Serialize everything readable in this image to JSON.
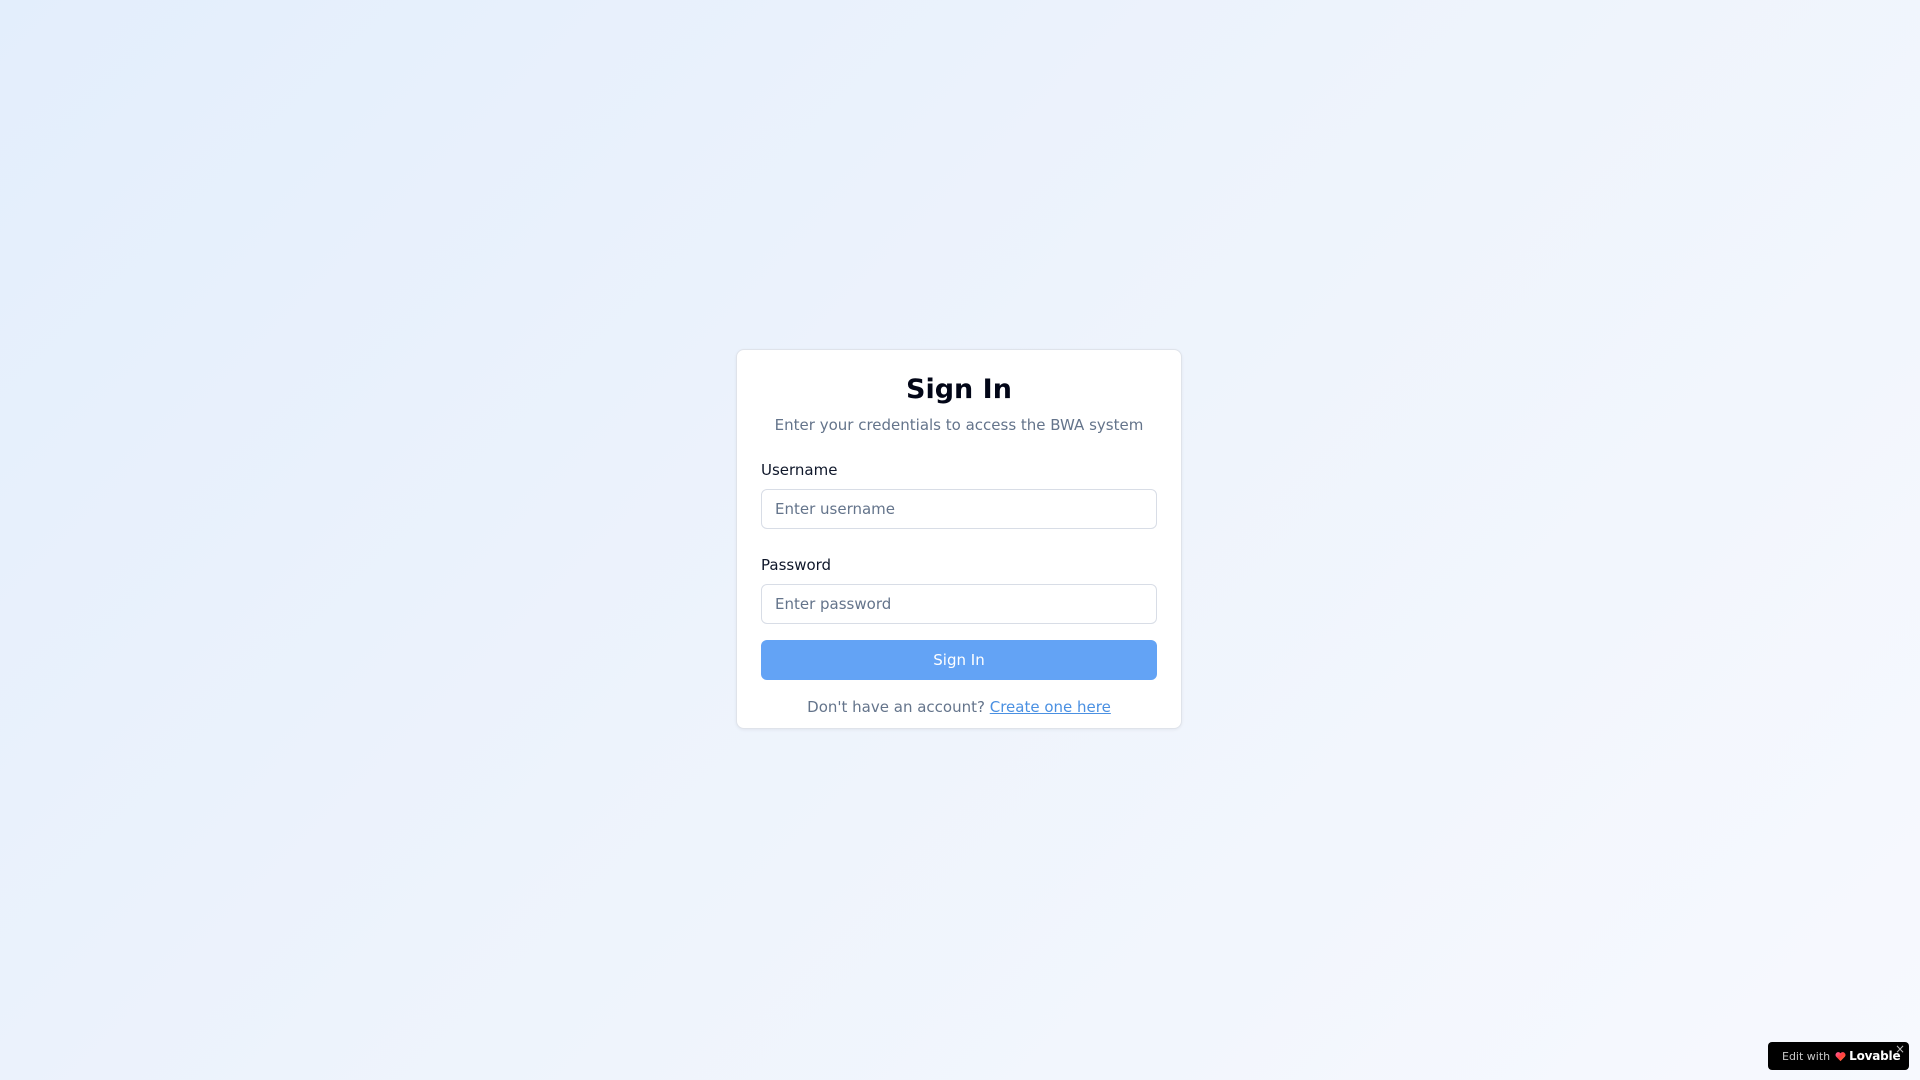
{
  "login": {
    "title": "Sign In",
    "subtitle": "Enter your credentials to access the BWA system",
    "username_label": "Username",
    "username_placeholder": "Enter username",
    "username_value": "",
    "password_label": "Password",
    "password_placeholder": "Enter password",
    "password_value": "",
    "submit_label": "Sign In",
    "footer_text": "Don't have an account?",
    "footer_link": "Create one here"
  },
  "badge": {
    "prefix": "Edit with",
    "brand": "Lovable",
    "close": "×",
    "icon": "heart-icon"
  },
  "colors": {
    "button": "#63a3f5",
    "link": "#4a90e2",
    "background": "#e8f0fd"
  }
}
